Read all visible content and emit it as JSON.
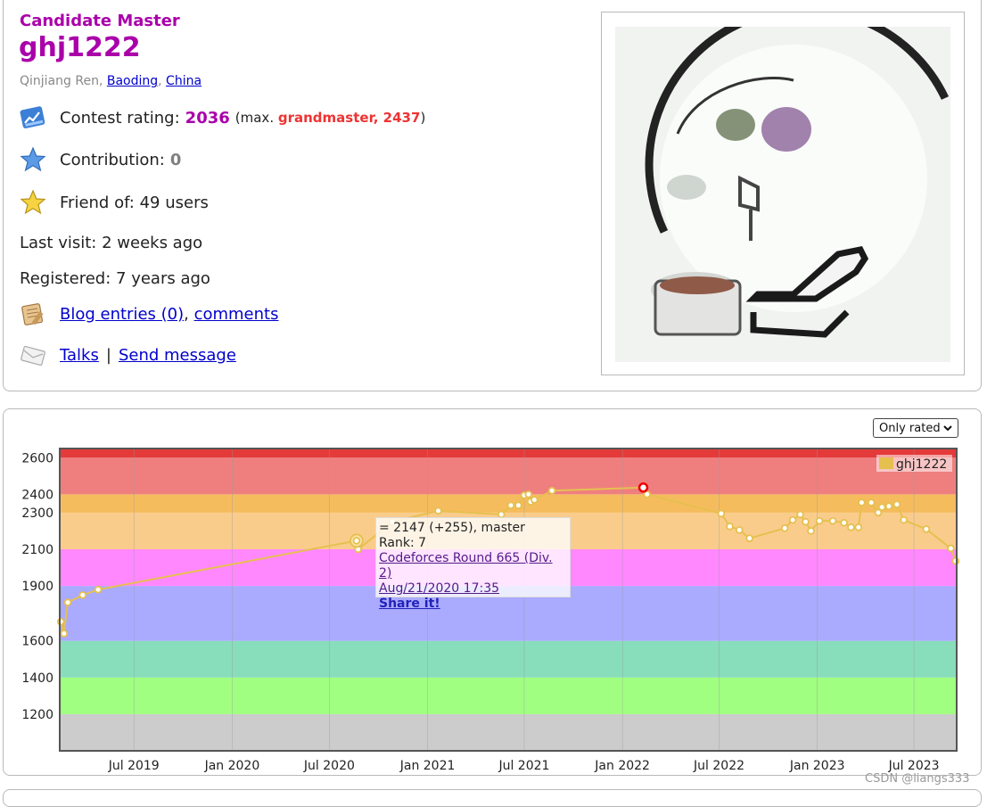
{
  "profile": {
    "rank_title": "Candidate Master",
    "handle": "ghj1222",
    "name": "Qinjiang Ren",
    "city": "Baoding",
    "country": "China",
    "rating_label": "Contest rating:",
    "rating_value": "2036",
    "max_open": "(max.",
    "max_rank": "grandmaster, 2437",
    "max_close": ")",
    "contribution_label": "Contribution:",
    "contribution_value": "0",
    "friend_label": "Friend of:",
    "friend_value": "49 users",
    "last_visit_label": "Last visit:",
    "last_visit_value": "2 weeks ago",
    "registered_label": "Registered:",
    "registered_value": "7 years ago",
    "blog_link": "Blog entries (0)",
    "comments_link": "comments",
    "talks_link": "Talks",
    "send_message_link": "Send message",
    "separator": "|"
  },
  "graph_controls": {
    "filter_selected": "Only rated"
  },
  "colors": {
    "candidate_master": "#aa00aa",
    "grandmaster": "#ee3333",
    "contribution_zero": "#808080",
    "series_line": "#e6c04f"
  },
  "tooltip": {
    "line1": "= 2147 (+255), master",
    "line2": "Rank: 7",
    "contest": "Codeforces Round 665 (Div. 2)",
    "date": "Aug/21/2020 17:35",
    "share": "Share it!"
  },
  "chart_data": {
    "type": "line",
    "x_type": "date",
    "ylim": [
      1000,
      2650
    ],
    "xlim": [
      "2019-02-12",
      "2023-09-19"
    ],
    "ytick_labels": [
      "1200",
      "1400",
      "1600",
      "1900",
      "2100",
      "2300",
      "2400",
      "2600"
    ],
    "xtick_labels": [
      "Jul 2019",
      "Jan 2020",
      "Jul 2020",
      "Jan 2021",
      "Jul 2021",
      "Jan 2022",
      "Jul 2022",
      "Jan 2023",
      "Jul 2023"
    ],
    "legend": "ghj1222",
    "legend_position": "top-right",
    "grid": true,
    "bands": [
      {
        "from": 1000,
        "to": 1200,
        "color": "#cccccc"
      },
      {
        "from": 1200,
        "to": 1400,
        "color": "#a0ff80"
      },
      {
        "from": 1400,
        "to": 1600,
        "color": "#88ddbb"
      },
      {
        "from": 1600,
        "to": 1900,
        "color": "#aaaaff"
      },
      {
        "from": 1900,
        "to": 2100,
        "color": "#ff88ff"
      },
      {
        "from": 2100,
        "to": 2300,
        "color": "#f9cc8c"
      },
      {
        "from": 2300,
        "to": 2400,
        "color": "#f5bc5e"
      },
      {
        "from": 2400,
        "to": 2600,
        "color": "#ef7f7f"
      },
      {
        "from": 2600,
        "to": 3000,
        "color": "#e43a3a"
      }
    ],
    "series": [
      {
        "name": "ghj1222",
        "color": "#e6c04f",
        "points": [
          [
            "2019-02-14",
            1705
          ],
          [
            "2019-02-20",
            1640
          ],
          [
            "2019-02-27",
            1810
          ],
          [
            "2019-03-27",
            1850
          ],
          [
            "2019-04-25",
            1880
          ],
          [
            "2020-08-21",
            2147
          ],
          [
            "2020-08-24",
            2100
          ],
          [
            "2020-10-27",
            2250
          ],
          [
            "2021-01-21",
            2310
          ],
          [
            "2021-05-19",
            2290
          ],
          [
            "2021-06-06",
            2340
          ],
          [
            "2021-06-20",
            2340
          ],
          [
            "2021-07-01",
            2395
          ],
          [
            "2021-07-09",
            2400
          ],
          [
            "2021-07-13",
            2360
          ],
          [
            "2021-07-20",
            2370
          ],
          [
            "2021-08-22",
            2420
          ],
          [
            "2022-02-09",
            2437
          ],
          [
            "2022-02-16",
            2400
          ],
          [
            "2022-07-05",
            2295
          ],
          [
            "2022-07-21",
            2225
          ],
          [
            "2022-08-08",
            2205
          ],
          [
            "2022-08-27",
            2160
          ],
          [
            "2022-11-01",
            2215
          ],
          [
            "2022-11-16",
            2260
          ],
          [
            "2022-11-30",
            2290
          ],
          [
            "2022-12-10",
            2250
          ],
          [
            "2022-12-20",
            2200
          ],
          [
            "2023-01-05",
            2255
          ],
          [
            "2023-01-30",
            2255
          ],
          [
            "2023-02-20",
            2245
          ],
          [
            "2023-03-05",
            2220
          ],
          [
            "2023-03-19",
            2220
          ],
          [
            "2023-03-25",
            2355
          ],
          [
            "2023-04-12",
            2355
          ],
          [
            "2023-04-25",
            2300
          ],
          [
            "2023-05-02",
            2330
          ],
          [
            "2023-05-15",
            2335
          ],
          [
            "2023-05-30",
            2345
          ],
          [
            "2023-06-12",
            2260
          ],
          [
            "2023-07-24",
            2210
          ],
          [
            "2023-09-08",
            2105
          ],
          [
            "2023-09-17",
            2036
          ]
        ]
      }
    ],
    "highlight_points": [
      {
        "date": "2020-08-21",
        "value": 2147,
        "style": "selected"
      },
      {
        "date": "2022-02-09",
        "value": 2437,
        "style": "max"
      }
    ]
  }
}
